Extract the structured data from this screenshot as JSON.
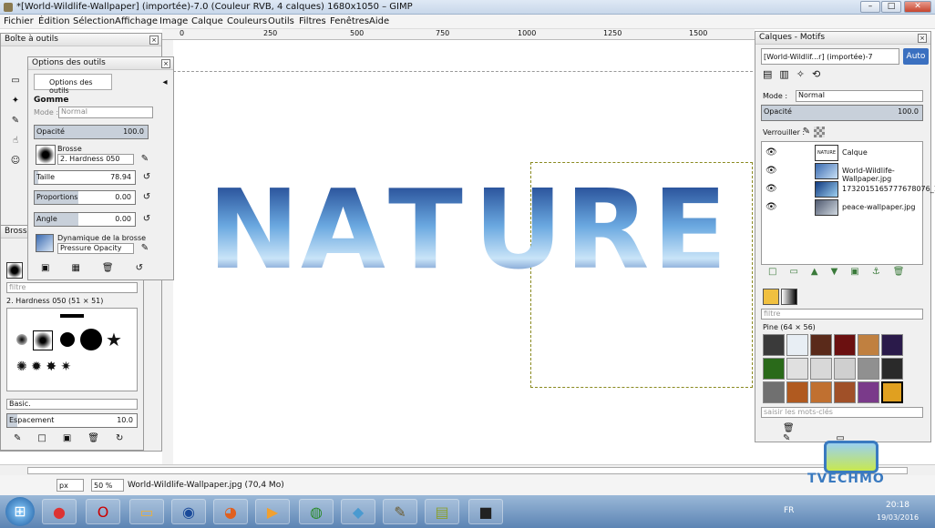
{
  "window": {
    "title": "*[World-Wildlife-Wallpaper] (importée)-7.0 (Couleur RVB, 4 calques) 1680x1050 – GIMP",
    "minimize": "–",
    "maximize": "□",
    "close": "✕"
  },
  "menu": [
    "Fichier",
    "Édition",
    "Sélection",
    "Affichage",
    "Image",
    "Calque",
    "Couleurs",
    "Outils",
    "Filtres",
    "Fenêtres",
    "Aide"
  ],
  "ruler": {
    "ticks": [
      "250",
      "500",
      "750",
      "1000",
      "1250",
      "1500"
    ],
    "zero": "0"
  },
  "canvas": {
    "letters": [
      "N",
      "A",
      "T",
      "U",
      "R",
      "E"
    ]
  },
  "toolbox": {
    "title": "Boîte à outils"
  },
  "tool_options": {
    "title": "Options des outils",
    "tab_label": "Options des outils",
    "tool_name": "Gomme",
    "mode_label": "Mode :",
    "mode_value": "Normal",
    "opacity_label": "Opacité",
    "opacity_value": "100.0",
    "opacity_fraction": 1.0,
    "brush_label": "Brosse",
    "brush_value": "2. Hardness 050",
    "size_label": "Taille",
    "size_value": "78.94",
    "ratio_label": "Proportions",
    "ratio_value": "0.00",
    "angle_label": "Angle",
    "angle_value": "0.00",
    "dynamics_label": "Dynamique de la brosse",
    "dynamics_value": "Pressure Opacity"
  },
  "brushes": {
    "title": "Brosses",
    "filter_placeholder": "filtre",
    "brush_name": "2. Hardness 050 (51 × 51)",
    "preset": "Basic.",
    "spacing_label": "Espacement",
    "spacing_value": "10.0"
  },
  "layers": {
    "title": "Calques - Motifs",
    "image_select": "[World-Wildlif...r] (importée)-7",
    "auto_label": "Auto",
    "mode_label": "Mode :",
    "mode_value": "Normal",
    "opacity_label": "Opacité",
    "opacity_value": "100.0",
    "lock_label": "Verrouiller :",
    "items": [
      {
        "name": "Calque",
        "thumb": "NATURE"
      },
      {
        "name": "World-Wildlife-Wallpaper.jpg",
        "thumb": ""
      },
      {
        "name": "1732015165777678076_12_17...",
        "thumb": ""
      },
      {
        "name": "peace-wallpaper.jpg",
        "thumb": ""
      }
    ]
  },
  "patterns": {
    "filter_placeholder": "filtre",
    "selected_name": "Pine (64 × 56)",
    "tags_placeholder": "saisir les mots-clés",
    "swatches": [
      "#3a3a3a",
      "#e8eef4",
      "#5a2a1a",
      "#6b1010",
      "#c08040",
      "#2a1a4a",
      "#2a6a1a",
      "#e0e0e0",
      "#d8d8d8",
      "#cfcfcf",
      "#909090",
      "#2a2a2a",
      "#707070",
      "#b05a20",
      "#c07030",
      "#a05028",
      "#7a3a8a",
      "#e0a020"
    ]
  },
  "status": {
    "unit": "px",
    "zoom": "50 %",
    "file_info": "World-Wildlife-Wallpaper.jpg (70,4 Mo)"
  },
  "taskbar": {
    "lang": "FR",
    "time": "20:18",
    "date": "19/03/2016",
    "watermark": "TVECHMO"
  }
}
